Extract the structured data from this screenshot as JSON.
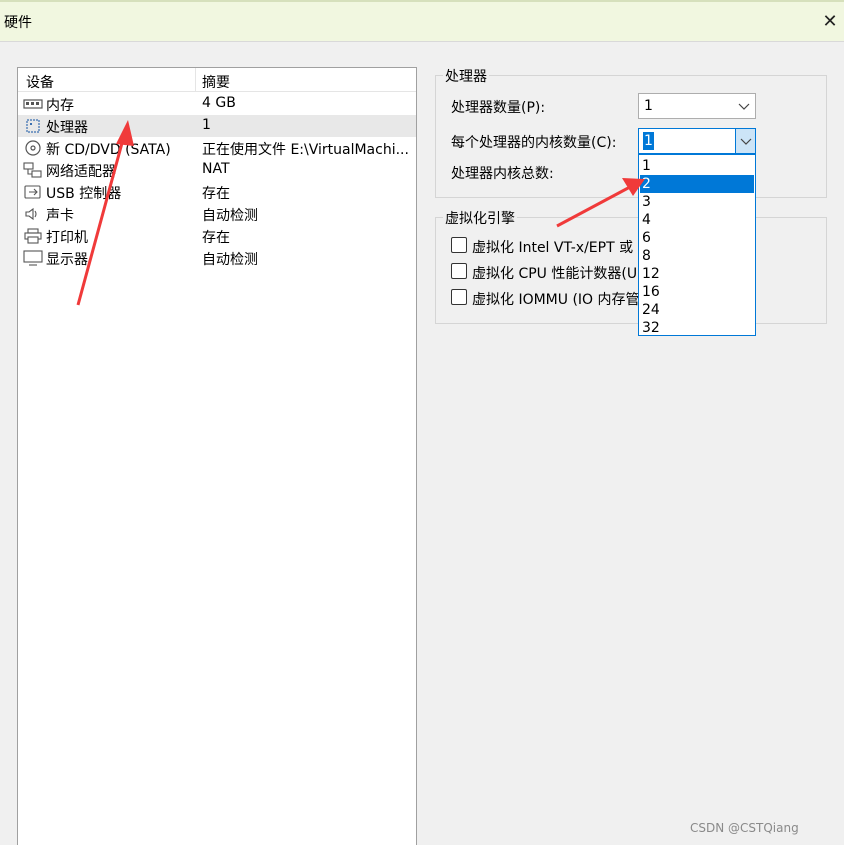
{
  "window": {
    "title": "硬件",
    "close_glyph": "✕"
  },
  "device_list": {
    "headers": {
      "device": "设备",
      "summary": "摘要"
    },
    "rows": [
      {
        "icon": "memory-icon",
        "name": "内存",
        "summary": "4 GB"
      },
      {
        "icon": "processor-icon",
        "name": "处理器",
        "summary": "1"
      },
      {
        "icon": "cd-dvd-icon",
        "name": "新 CD/DVD (SATA)",
        "summary": "正在使用文件 E:\\VirtualMachi..."
      },
      {
        "icon": "network-adapter-icon",
        "name": "网络适配器",
        "summary": "NAT"
      },
      {
        "icon": "usb-controller-icon",
        "name": "USB 控制器",
        "summary": "存在"
      },
      {
        "icon": "sound-card-icon",
        "name": "声卡",
        "summary": "自动检测"
      },
      {
        "icon": "printer-icon",
        "name": "打印机",
        "summary": "存在"
      },
      {
        "icon": "display-icon",
        "name": "显示器",
        "summary": "自动检测"
      }
    ]
  },
  "processor": {
    "group_title": "处理器",
    "count_label": "处理器数量(P):",
    "count_value": "1",
    "cores_label": "每个处理器的内核数量(C):",
    "cores_value": "1",
    "total_label": "处理器内核总数:",
    "cores_options": [
      "1",
      "2",
      "3",
      "4",
      "6",
      "8",
      "12",
      "16",
      "24",
      "32"
    ],
    "cores_highlighted": "2"
  },
  "virtualization": {
    "group_title": "虚拟化引擎",
    "options": [
      {
        "label": "虚拟化 Intel VT-x/EPT 或",
        "checked": false
      },
      {
        "label": "虚拟化 CPU 性能计数器(U",
        "checked": false
      },
      {
        "label": "虚拟化 IOMMU (IO 内存管",
        "checked": false
      }
    ]
  },
  "watermark": "CSDN @CSTQiang",
  "colors": {
    "accent": "#0078d7",
    "title_bar": "#f1f7e0",
    "annotation_arrow": "#f03a3a"
  }
}
